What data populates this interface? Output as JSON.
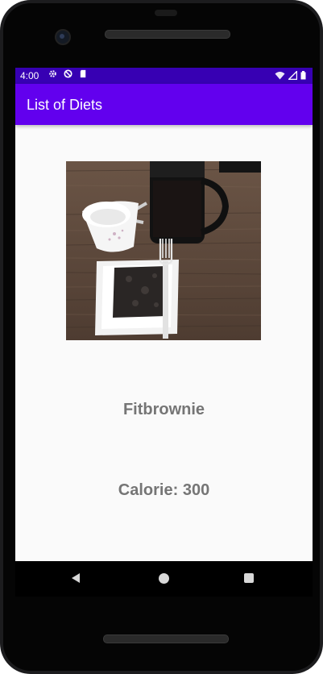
{
  "status_bar": {
    "time": "4:00",
    "left_icons": [
      "gear-icon",
      "data-saver-icon",
      "sd-card-icon"
    ],
    "right_icons": [
      "wifi-icon",
      "signal-icon",
      "battery-icon"
    ]
  },
  "app_bar": {
    "title": "List of Diets",
    "color": "#6200ee",
    "status_color": "#3700b3"
  },
  "diet_item": {
    "image_alt": "brownie on a white plate with a fork, a white cup and a french press",
    "name": "Fitbrownie",
    "calorie": "Calorie: 300"
  },
  "nav_bar": {
    "buttons": [
      "back-icon",
      "home-icon",
      "recent-apps-icon"
    ]
  }
}
